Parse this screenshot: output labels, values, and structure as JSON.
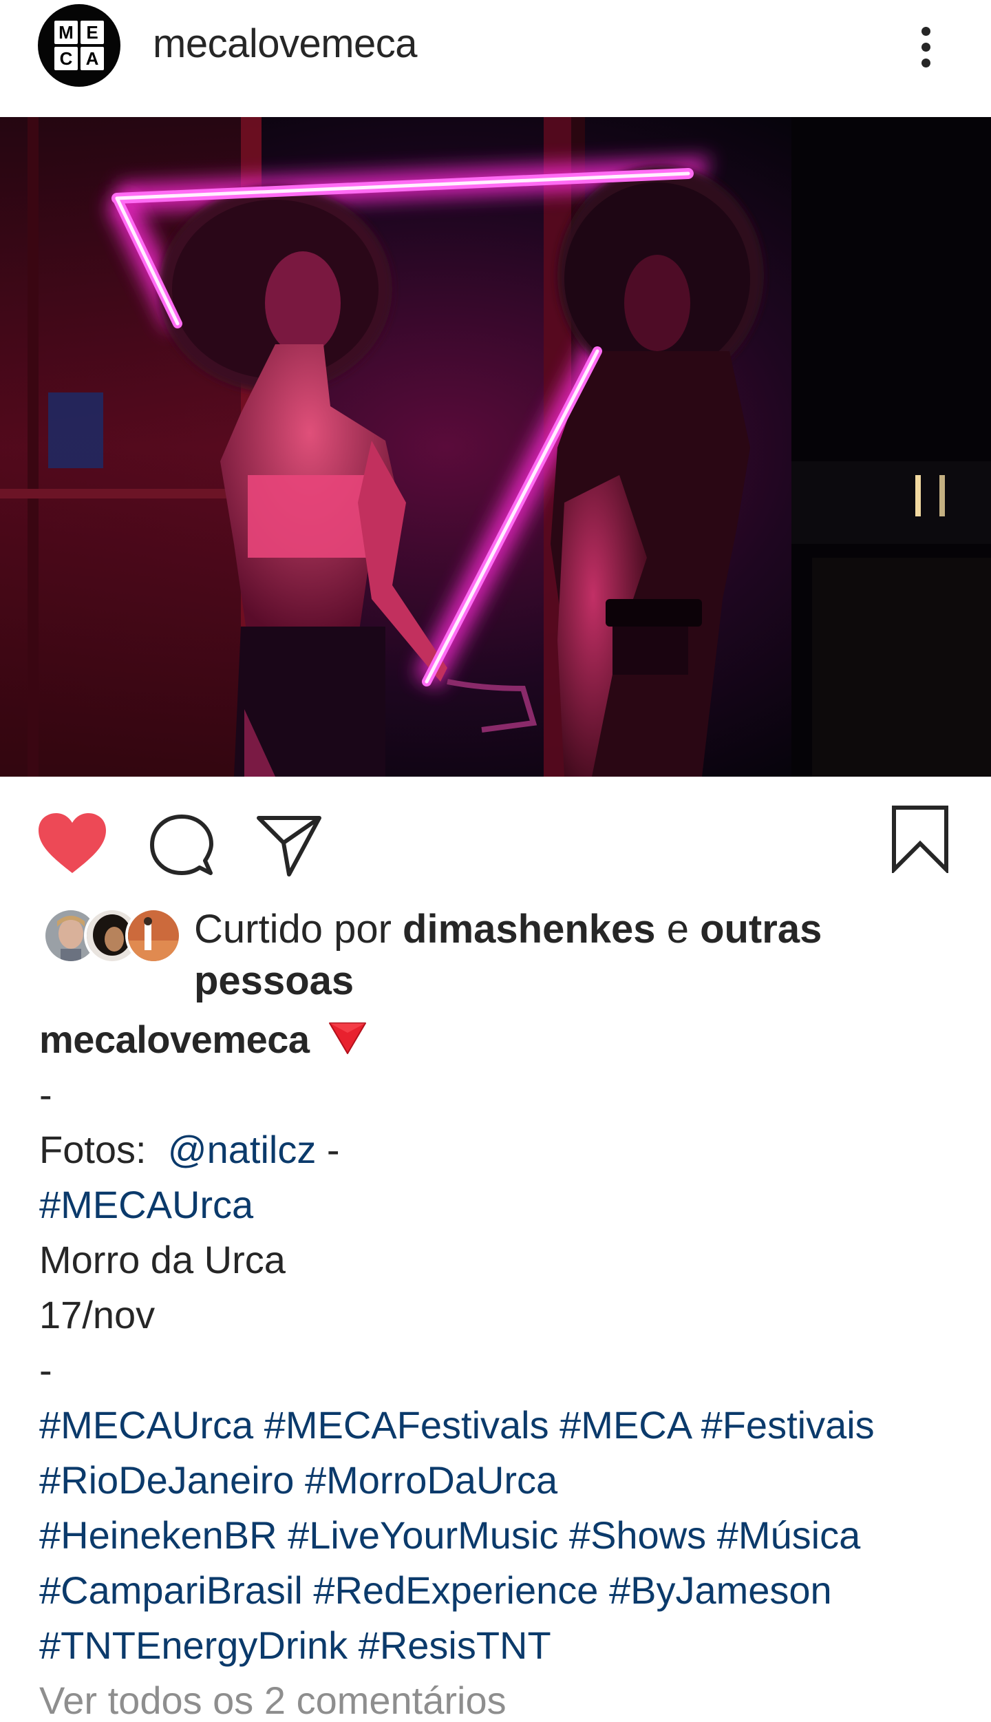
{
  "header": {
    "avatar_letters": [
      "M",
      "E",
      "C",
      "A"
    ],
    "username": "mecalovemeca",
    "more_icon": "more-vertical-icon"
  },
  "post": {
    "image_description_icon": "photo",
    "actions": {
      "like_icon": "heart-filled-icon",
      "comment_icon": "comment-icon",
      "share_icon": "send-icon",
      "save_icon": "bookmark-icon",
      "like_color": "#ed4956"
    },
    "likes": {
      "prefix": "Curtido por",
      "user": "dimashenkes",
      "conjunction": "e",
      "others": "outras pessoas"
    },
    "caption": {
      "author": "mecalovemeca",
      "emoji": "red-triangle-pointed-down",
      "line_dash_1": "-",
      "fotos_label": "Fotos:",
      "fotos_mention": "@natilcz",
      "fotos_suffix": "-",
      "tag_line": "#MECAUrca",
      "location": "Morro da Urca",
      "date": "17/nov",
      "line_dash_2": "-",
      "hashtag_lines": [
        "#MECAUrca #MECAFestivals #MECA #Festivais",
        "#RioDeJaneiro #MorroDaUrca",
        "#HeinekenBR #LiveYourMusic #Shows #Música",
        "#CampariBrasil #RedExperience #ByJameson",
        "#TNTEnergyDrink #ResisTNT"
      ]
    },
    "more_comments": "Ver todos os 2 comentários"
  },
  "colors": {
    "text": "#262626",
    "link": "#0b3a6b",
    "like": "#ed4956",
    "neon": "#ff3cf2"
  }
}
